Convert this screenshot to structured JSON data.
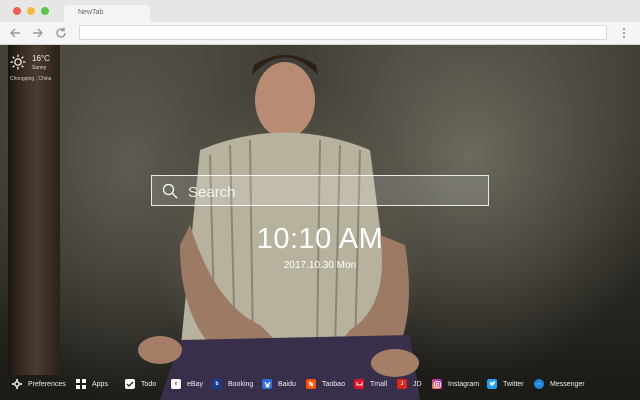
{
  "browser": {
    "tab_title": "NewTab",
    "url": ""
  },
  "weather": {
    "temperature": "16°C",
    "condition": "Sunny",
    "city": "Chongqing , China"
  },
  "search": {
    "placeholder": "Search"
  },
  "clock": {
    "time": "10:10 AM",
    "date": "2017.10.30 Mon"
  },
  "bottom_bar": {
    "items": [
      {
        "label": "Preferences",
        "icon": "gear-icon",
        "color": "#ffffff"
      },
      {
        "label": "Apps",
        "icon": "grid-icon",
        "color": "#ffffff"
      },
      {
        "label": "Todo",
        "icon": "checkbox-icon",
        "color": "#ffffff"
      },
      {
        "label": "eBay",
        "icon": "ebay-icon",
        "color": "#ffffff"
      },
      {
        "label": "Booking",
        "icon": "booking-icon",
        "color": "#1a3a8a"
      },
      {
        "label": "Baidu",
        "icon": "baidu-icon",
        "color": "#2f6ee0"
      },
      {
        "label": "Taobao",
        "icon": "taobao-icon",
        "color": "#ff5000"
      },
      {
        "label": "Tmall",
        "icon": "tmall-icon",
        "color": "#e0102a"
      },
      {
        "label": "JD",
        "icon": "jd-icon",
        "color": "#e1251b"
      },
      {
        "label": "Instagram",
        "icon": "instagram-icon",
        "color": "#d63a8a"
      },
      {
        "label": "Twitter",
        "icon": "twitter-icon",
        "color": "#1da1f2"
      },
      {
        "label": "Messenger",
        "icon": "messenger-icon",
        "color": "#1e88e5"
      }
    ]
  }
}
